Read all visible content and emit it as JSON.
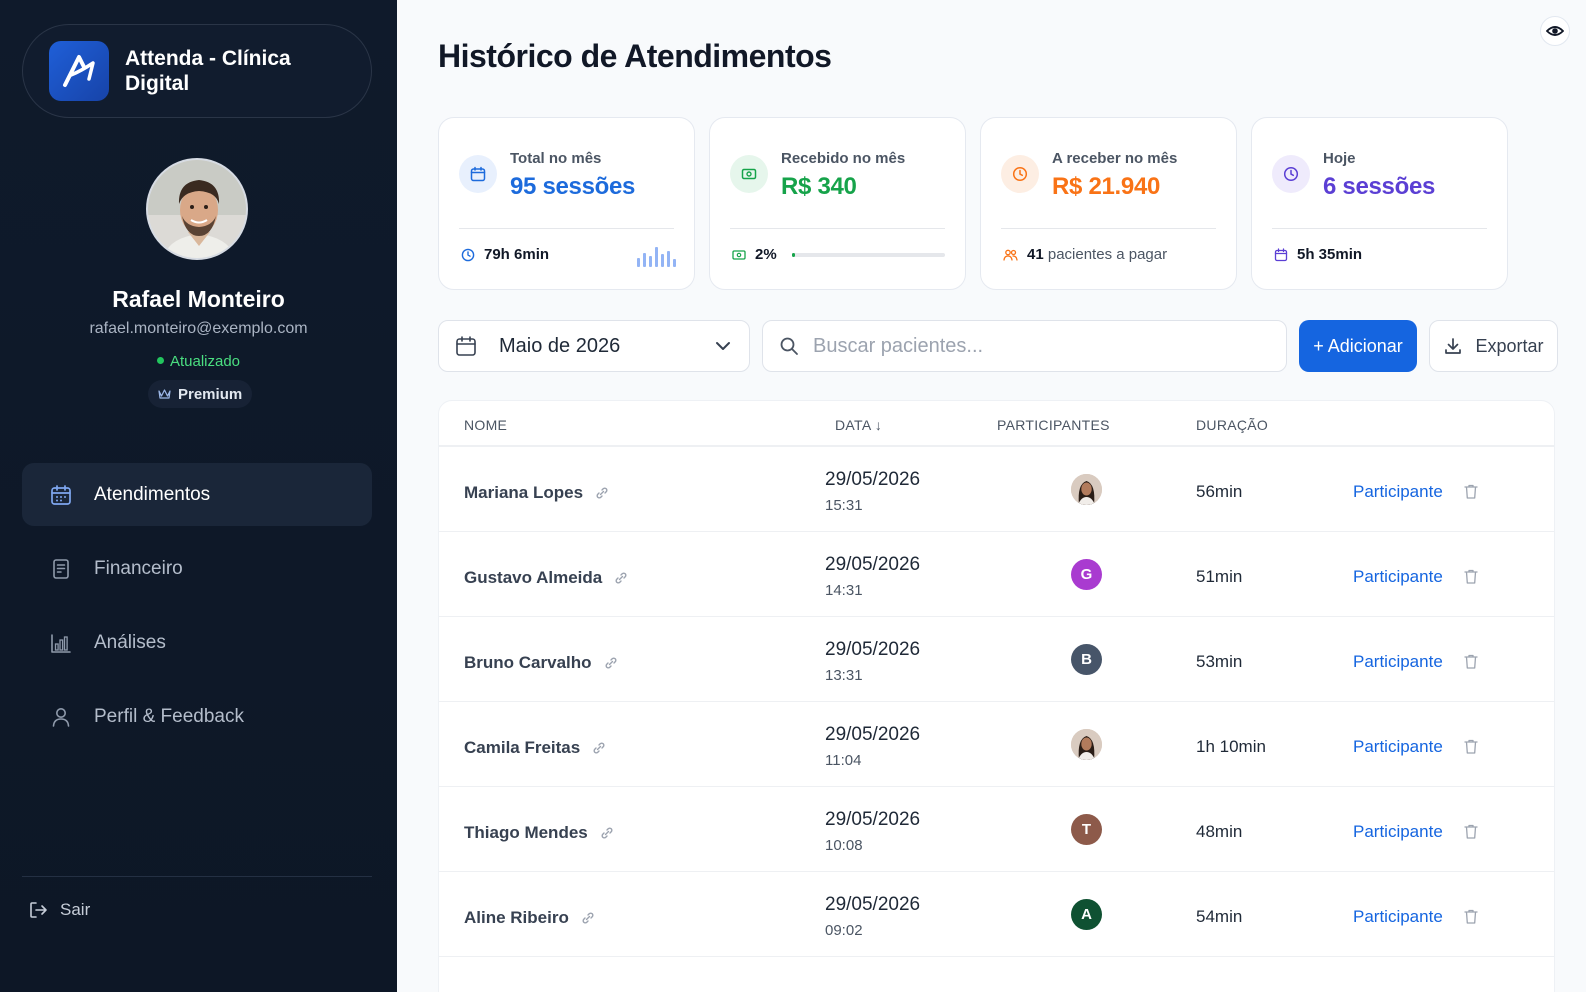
{
  "sidebar": {
    "brand_name": "Attenda - Clínica Digital",
    "user": {
      "name": "Rafael Monteiro",
      "email": "rafael.monteiro@exemplo.com",
      "status": "Atualizado",
      "plan": "Premium"
    },
    "nav": [
      {
        "label": "Atendimentos",
        "icon": "calendar-icon",
        "active": true
      },
      {
        "label": "Financeiro",
        "icon": "document-icon",
        "active": false
      },
      {
        "label": "Análises",
        "icon": "bar-chart-icon",
        "active": false
      },
      {
        "label": "Perfil & Feedback",
        "icon": "user-icon",
        "active": false
      }
    ],
    "logout_label": "Sair"
  },
  "main": {
    "title": "Histórico de Atendimentos",
    "stats": [
      {
        "label": "Total no mês",
        "value": "95 sessões",
        "color": "#1d6bdc",
        "icon": "calendar-icon",
        "footer_value": "79h 6min",
        "footer_text": "",
        "footer_icon": "clock-icon"
      },
      {
        "label": "Recebido no mês",
        "value": "R$ 340",
        "color": "#16a34a",
        "icon": "cash-icon",
        "footer_value": "2%",
        "footer_text": "",
        "footer_icon": "cash-icon",
        "progress": 0.02
      },
      {
        "label": "A receber no mês",
        "value": "R$ 21.940",
        "color": "#f97316",
        "icon": "clock-icon",
        "footer_value": "41",
        "footer_text": "pacientes a pagar",
        "footer_icon": "users-icon"
      },
      {
        "label": "Hoje",
        "value": "6 sessões",
        "color": "#5b3fd4",
        "icon": "clock-icon",
        "footer_value": "5h 35min",
        "footer_text": "",
        "footer_icon": "calendar-icon"
      }
    ],
    "month_select": "Maio de 2026",
    "search_placeholder": "Buscar pacientes...",
    "add_button": "+ Adicionar",
    "export_button": "Exportar",
    "table": {
      "headers": {
        "name": "NOME",
        "date": "DATA ↓",
        "participants": "PARTICIPANTES",
        "duration": "DURAÇÃO"
      },
      "rows": [
        {
          "name": "Mariana Lopes",
          "date": "29/05/2026",
          "time": "15:31",
          "participant": "",
          "participant_color": "#d6c3b6",
          "participant_photo": true,
          "duration": "56min",
          "action": "Participante"
        },
        {
          "name": "Gustavo Almeida",
          "date": "29/05/2026",
          "time": "14:31",
          "participant": "G",
          "participant_color": "#a93bd0",
          "participant_photo": false,
          "duration": "51min",
          "action": "Participante"
        },
        {
          "name": "Bruno Carvalho",
          "date": "29/05/2026",
          "time": "13:31",
          "participant": "B",
          "participant_color": "#475569",
          "participant_photo": false,
          "duration": "53min",
          "action": "Participante"
        },
        {
          "name": "Camila Freitas",
          "date": "29/05/2026",
          "time": "11:04",
          "participant": "",
          "participant_color": "#d6c3b6",
          "participant_photo": true,
          "duration": "1h 10min",
          "action": "Participante"
        },
        {
          "name": "Thiago Mendes",
          "date": "29/05/2026",
          "time": "10:08",
          "participant": "T",
          "participant_color": "#8d5a4a",
          "participant_photo": false,
          "duration": "48min",
          "action": "Participante"
        },
        {
          "name": "Aline Ribeiro",
          "date": "29/05/2026",
          "time": "09:02",
          "participant": "A",
          "participant_color": "#0f5132",
          "participant_photo": false,
          "duration": "54min",
          "action": "Participante"
        }
      ]
    }
  }
}
